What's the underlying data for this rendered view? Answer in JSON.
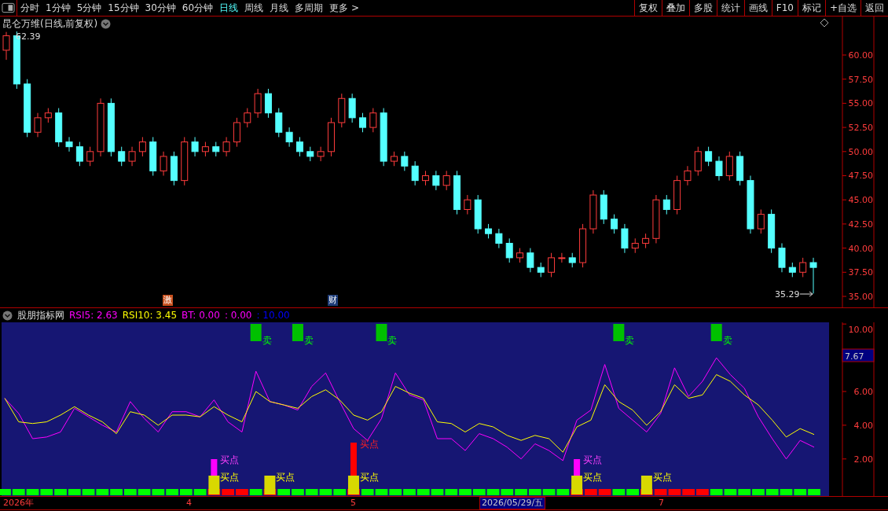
{
  "toolbar": {
    "periods": [
      {
        "label": "分时",
        "selected": false
      },
      {
        "label": "1分钟",
        "selected": false
      },
      {
        "label": "5分钟",
        "selected": false
      },
      {
        "label": "15分钟",
        "selected": false
      },
      {
        "label": "30分钟",
        "selected": false
      },
      {
        "label": "60分钟",
        "selected": false
      },
      {
        "label": "日线",
        "selected": true
      },
      {
        "label": "周线",
        "selected": false
      },
      {
        "label": "月线",
        "selected": false
      },
      {
        "label": "多周期",
        "selected": false
      },
      {
        "label": "更多 >",
        "selected": false
      }
    ],
    "buttons": [
      "复权",
      "叠加",
      "多股",
      "统计",
      "画线",
      "F10",
      "标记",
      "+自选",
      "返回"
    ]
  },
  "price_panel": {
    "title": "昆仑万维(日线,前复权)",
    "high_label": "62.39",
    "low_label": "35.29",
    "events": [
      {
        "label": "激",
        "color": "#c8501e"
      },
      {
        "label": "财",
        "color": "#1e3c78"
      }
    ],
    "chart_data": {
      "type": "candlestick",
      "ylim": [
        33.86,
        63.99
      ],
      "yticks": [
        {
          "value": 35,
          "label": "35.00"
        },
        {
          "value": 37.5,
          "label": "37.50"
        },
        {
          "value": 40,
          "label": "40.00"
        },
        {
          "value": 42.5,
          "label": "42.50"
        },
        {
          "value": 45,
          "label": "45.00"
        },
        {
          "value": 47.5,
          "label": "47.50"
        },
        {
          "value": 50,
          "label": "50.00"
        },
        {
          "value": 52.5,
          "label": "52.50"
        },
        {
          "value": 55,
          "label": "55.00"
        },
        {
          "value": 57.5,
          "label": "57.50"
        },
        {
          "value": 60,
          "label": "60.00"
        }
      ],
      "categories": [
        null,
        null,
        null,
        null,
        null,
        null,
        null,
        null,
        null,
        null,
        null,
        null,
        null,
        null,
        null,
        null,
        null,
        null,
        null,
        null,
        null,
        null,
        null,
        null,
        null,
        null,
        null,
        null,
        null,
        null,
        null,
        null,
        null,
        null,
        null,
        null,
        null,
        null,
        null,
        null,
        null,
        null,
        null,
        null,
        null,
        null,
        null,
        null,
        null,
        null,
        null,
        null,
        null,
        null,
        null,
        null,
        null,
        null,
        null,
        null,
        null,
        null,
        null,
        null,
        null,
        null,
        null,
        null,
        null,
        null,
        null,
        null,
        null,
        null,
        null,
        null,
        null,
        null
      ],
      "ohlc": [
        [
          60.5,
          62.39,
          59.5,
          62
        ],
        [
          62,
          62.5,
          56.5,
          57
        ],
        [
          57,
          57.5,
          51.5,
          52
        ],
        [
          52,
          54,
          51.5,
          53.5
        ],
        [
          53.5,
          54.5,
          53,
          54
        ],
        [
          54,
          54.5,
          50.5,
          51
        ],
        [
          51,
          51.5,
          50,
          50.5
        ],
        [
          50.5,
          51,
          48.5,
          49
        ],
        [
          49,
          50.5,
          48.5,
          50
        ],
        [
          50,
          55.5,
          49.5,
          55
        ],
        [
          55,
          55.5,
          49.5,
          50
        ],
        [
          50,
          50.5,
          48.5,
          49
        ],
        [
          49,
          50.5,
          48.5,
          50
        ],
        [
          50,
          51.5,
          49.5,
          51
        ],
        [
          51,
          51.5,
          47.5,
          48
        ],
        [
          48,
          50,
          47.5,
          49.5
        ],
        [
          49.5,
          50,
          46.5,
          47
        ],
        [
          47,
          51.5,
          46.5,
          51
        ],
        [
          51,
          51.5,
          49.5,
          50
        ],
        [
          50,
          51,
          49.5,
          50.5
        ],
        [
          50.5,
          51,
          49.5,
          50
        ],
        [
          50,
          51.5,
          49.5,
          51
        ],
        [
          51,
          53.5,
          50.5,
          53
        ],
        [
          53,
          54.5,
          52.5,
          54
        ],
        [
          54,
          56.5,
          53.5,
          56
        ],
        [
          56,
          56.5,
          53.5,
          54
        ],
        [
          54,
          54.5,
          51.5,
          52
        ],
        [
          52,
          52.5,
          50.5,
          51
        ],
        [
          51,
          51.5,
          49.5,
          50
        ],
        [
          50,
          50.5,
          49,
          49.5
        ],
        [
          49.5,
          50.5,
          49,
          50
        ],
        [
          50,
          53.5,
          49.5,
          53
        ],
        [
          53,
          56,
          52.5,
          55.5
        ],
        [
          55.5,
          56,
          53,
          53.5
        ],
        [
          53.5,
          54,
          52,
          52.5
        ],
        [
          52.5,
          54.5,
          52,
          54
        ],
        [
          54,
          54.5,
          48.5,
          49
        ],
        [
          49,
          50,
          48.5,
          49.5
        ],
        [
          49.5,
          50,
          48,
          48.5
        ],
        [
          48.5,
          49,
          46.5,
          47
        ],
        [
          47,
          48,
          46.5,
          47.5
        ],
        [
          47.5,
          48,
          46,
          46.5
        ],
        [
          46.5,
          48,
          46,
          47.5
        ],
        [
          47.5,
          48,
          43.5,
          44
        ],
        [
          44,
          45.5,
          43.5,
          45
        ],
        [
          45,
          45.5,
          41.5,
          42
        ],
        [
          42,
          42.5,
          41,
          41.5
        ],
        [
          41.5,
          42,
          40,
          40.5
        ],
        [
          40.5,
          41,
          38.5,
          39
        ],
        [
          39,
          40,
          38.5,
          39.5
        ],
        [
          39.5,
          40,
          37.5,
          38
        ],
        [
          38,
          38.5,
          37,
          37.5
        ],
        [
          37.5,
          39.5,
          37,
          39
        ],
        [
          39,
          39.5,
          38.5,
          39
        ],
        [
          39,
          39.5,
          38,
          38.5
        ],
        [
          38.5,
          42.5,
          38,
          42
        ],
        [
          42,
          46,
          41.5,
          45.5
        ],
        [
          45.5,
          46,
          42.5,
          43
        ],
        [
          43,
          43.5,
          41.5,
          42
        ],
        [
          42,
          42.5,
          39.5,
          40
        ],
        [
          40,
          41,
          39.5,
          40.5
        ],
        [
          40.5,
          41.5,
          40,
          41
        ],
        [
          41,
          45.5,
          40.5,
          45
        ],
        [
          45,
          45.5,
          43.5,
          44
        ],
        [
          44,
          47.5,
          43.5,
          47
        ],
        [
          47,
          48.5,
          46.5,
          48
        ],
        [
          48,
          50.5,
          47.5,
          50
        ],
        [
          50,
          50.5,
          48.5,
          49
        ],
        [
          49,
          49.5,
          47,
          47.5
        ],
        [
          47.5,
          50,
          47,
          49.5
        ],
        [
          49.5,
          50,
          46.5,
          47
        ],
        [
          47,
          47.5,
          41.5,
          42
        ],
        [
          42,
          44,
          41.5,
          43.5
        ],
        [
          43.5,
          44,
          39.5,
          40
        ],
        [
          40,
          40.5,
          37.5,
          38
        ],
        [
          38,
          38.5,
          37,
          37.5
        ],
        [
          37.5,
          39,
          37,
          38.5
        ],
        [
          38.5,
          39,
          35.29,
          38
        ]
      ]
    }
  },
  "indicator_panel": {
    "title": "股朋指标网",
    "readings": [
      {
        "value": ": 2.63"
      },
      {
        "value": ": 3.45"
      }
    ],
    "extra_readings": [
      {
        "text": "BT: 0.00",
        "color": "#ff00ff"
      },
      {
        "text": ": 0.00",
        "color": "#ff00ff"
      },
      {
        "text": ": 10.00",
        "color": "#0000ff"
      }
    ],
    "cursor_value": "7.67",
    "chart_data": {
      "type": "line",
      "ylim": [
        -0.2,
        10.1
      ],
      "yticks": [
        {
          "value": 2,
          "label": "2.00"
        },
        {
          "value": 4,
          "label": "4.00"
        },
        {
          "value": 6,
          "label": "6.00"
        },
        {
          "value": 10,
          "label": "10.00"
        }
      ],
      "series": [
        {
          "name": "RSI5",
          "color": "#ff00ff",
          "values": [
            5.6,
            4.7,
            3.2,
            3.3,
            3.6,
            5.0,
            4.5,
            4.0,
            3.6,
            5.4,
            4.4,
            3.6,
            4.8,
            4.8,
            4.5,
            5.5,
            4.2,
            3.6,
            7.2,
            5.4,
            5.2,
            4.9,
            6.3,
            7.1,
            5.4,
            3.8,
            3.1,
            4.4,
            7.1,
            5.8,
            5.5,
            3.2,
            3.2,
            2.5,
            3.5,
            3.2,
            2.7,
            2.0,
            2.9,
            2.5,
            1.9,
            4.3,
            4.9,
            7.6,
            5.0,
            4.3,
            3.6,
            4.7,
            7.4,
            5.7,
            6.6,
            8.0,
            7.0,
            6.2,
            4.5,
            3.2,
            2.0,
            3.1,
            2.7
          ]
        },
        {
          "name": "RSI10",
          "color": "#ffff00",
          "values": [
            5.6,
            4.2,
            4.1,
            4.2,
            4.6,
            5.1,
            4.6,
            4.2,
            3.5,
            4.8,
            4.6,
            4.0,
            4.6,
            4.6,
            4.5,
            5.1,
            4.6,
            4.2,
            6.0,
            5.4,
            5.2,
            5.0,
            5.7,
            6.1,
            5.5,
            4.6,
            4.3,
            4.8,
            6.3,
            5.9,
            5.6,
            4.2,
            4.1,
            3.6,
            4.1,
            3.9,
            3.4,
            3.1,
            3.4,
            3.2,
            2.4,
            3.9,
            4.3,
            6.4,
            5.4,
            4.9,
            4.0,
            4.8,
            6.4,
            5.6,
            5.8,
            7.0,
            6.6,
            5.8,
            5.2,
            4.3,
            3.3,
            3.8,
            3.45
          ]
        }
      ]
    },
    "signals": [
      {
        "color": "#00ff00"
      },
      {
        "color": "#00ff00"
      },
      {
        "color": "#00ff00"
      },
      {
        "color": "#00ff00"
      },
      {
        "color": "#00ff00"
      },
      {
        "color": "#00ff00"
      },
      {
        "color": "#00ff00"
      },
      {
        "color": "#00ff00"
      },
      {
        "color": "#00ff00"
      },
      {
        "color": "#00ff00"
      },
      {
        "color": "#00ff00"
      },
      {
        "color": "#00ff00"
      },
      {
        "color": "#00ff00"
      },
      {
        "color": "#00ff00"
      },
      {
        "color": "#00ff00"
      },
      {
        "color": "#ff0000",
        "marks": [
          {
            "kind": "buy_strong",
            "label": "买点"
          },
          {
            "kind": "buy",
            "label": "买点"
          }
        ]
      },
      {
        "color": "#ff0000"
      },
      {
        "color": "#ff0000"
      },
      {
        "color": "#00ff00",
        "marks": [
          {
            "kind": "sell",
            "label": "卖"
          }
        ]
      },
      {
        "color": "#ff0000",
        "marks": [
          {
            "kind": "buy",
            "label": "买点"
          }
        ]
      },
      {
        "color": "#00ff00"
      },
      {
        "color": "#00ff00",
        "marks": [
          {
            "kind": "sell",
            "label": "卖"
          }
        ]
      },
      {
        "color": "#00ff00"
      },
      {
        "color": "#00ff00"
      },
      {
        "color": "#00ff00"
      },
      {
        "color": "#ff0000",
        "marks": [
          {
            "kind": "buy_peak",
            "label": "买点"
          },
          {
            "kind": "buy",
            "label": "买点"
          }
        ]
      },
      {
        "color": "#00ff00"
      },
      {
        "color": "#00ff00",
        "marks": [
          {
            "kind": "sell",
            "label": "卖"
          }
        ]
      },
      {
        "color": "#00ff00"
      },
      {
        "color": "#00ff00"
      },
      {
        "color": "#00ff00"
      },
      {
        "color": "#00ff00"
      },
      {
        "color": "#00ff00"
      },
      {
        "color": "#00ff00"
      },
      {
        "color": "#00ff00"
      },
      {
        "color": "#00ff00"
      },
      {
        "color": "#00ff00"
      },
      {
        "color": "#00ff00"
      },
      {
        "color": "#00ff00"
      },
      {
        "color": "#00ff00"
      },
      {
        "color": "#00ff00"
      },
      {
        "color": "#ff0000",
        "marks": [
          {
            "kind": "buy_strong",
            "label": "买点"
          },
          {
            "kind": "buy",
            "label": "买点"
          }
        ]
      },
      {
        "color": "#ff0000"
      },
      {
        "color": "#ff0000"
      },
      {
        "color": "#00ff00",
        "marks": [
          {
            "kind": "sell",
            "label": "卖"
          }
        ]
      },
      {
        "color": "#00ff00"
      },
      {
        "color": "#ff0000",
        "marks": [
          {
            "kind": "buy",
            "label": "买点"
          }
        ]
      },
      {
        "color": "#ff0000"
      },
      {
        "color": "#ff0000"
      },
      {
        "color": "#ff0000"
      },
      {
        "color": "#ff0000"
      },
      {
        "color": "#00ff00",
        "marks": [
          {
            "kind": "sell",
            "label": "卖"
          }
        ]
      },
      {
        "color": "#00ff00"
      },
      {
        "color": "#00ff00"
      },
      {
        "color": "#00ff00"
      },
      {
        "color": "#00ff00"
      },
      {
        "color": "#00ff00"
      },
      {
        "color": "#00ff00"
      },
      {
        "color": "#00ff00"
      }
    ]
  },
  "date_axis": [
    {
      "label": "2026年",
      "selected": false
    },
    {
      "label": "4",
      "selected": false
    },
    {
      "label": "5",
      "selected": false
    },
    {
      "label": "2026/05/29/五",
      "selected": true
    },
    {
      "label": "7",
      "selected": false
    }
  ]
}
